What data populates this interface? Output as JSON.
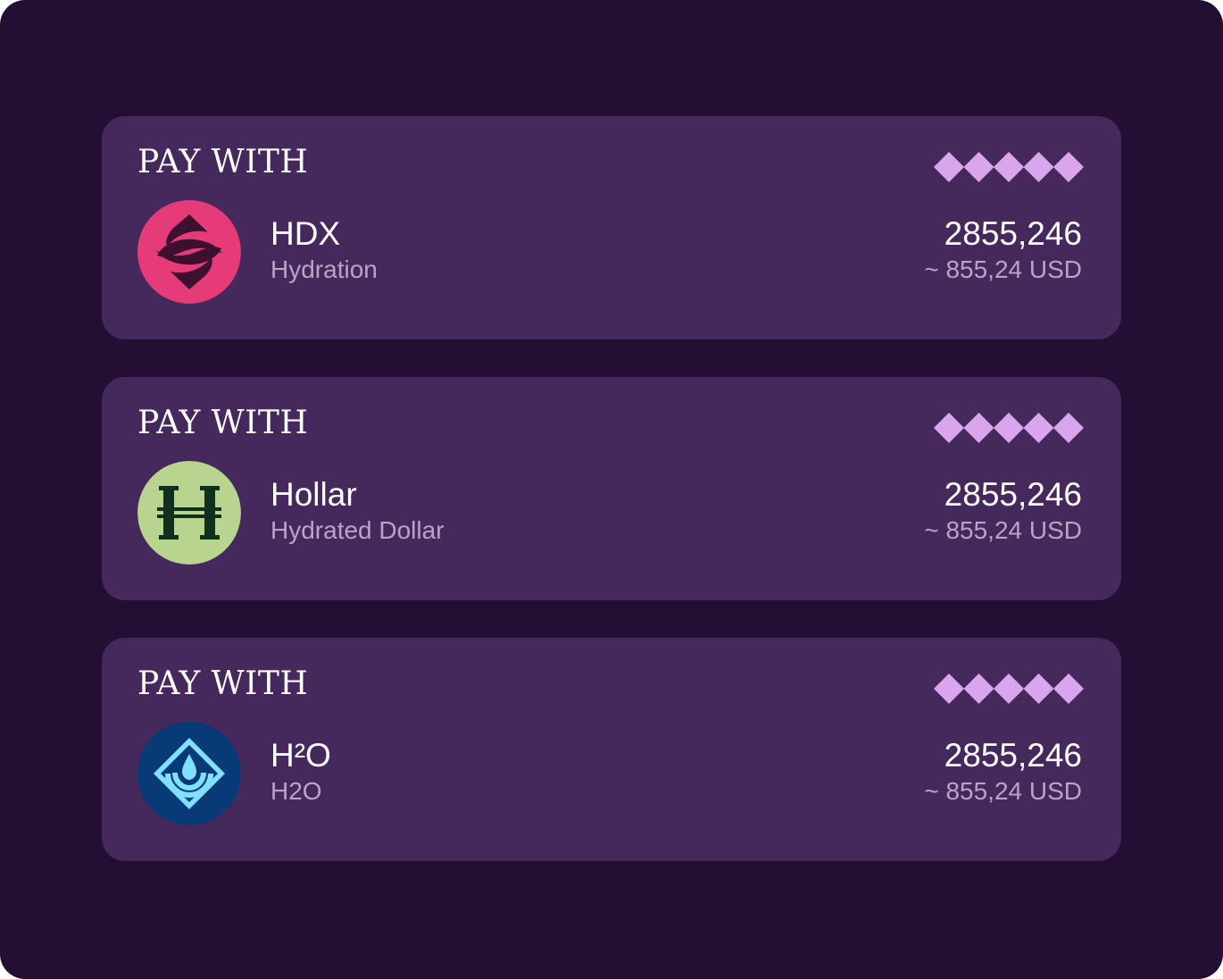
{
  "colors": {
    "frame_bg": "#220f33",
    "card_bg": "#45285c",
    "diamond": "#d9a6ee",
    "text_primary": "#ffffff",
    "text_secondary": "#b6a6c6",
    "hdx_logo_bg": "#e53b78",
    "hollar_logo_bg": "#b8d48f",
    "h2o_logo_bg": "#083a78",
    "h2o_logo_fg": "#7fe0ff"
  },
  "cards": [
    {
      "label": "PAY WITH",
      "rating_icon": "diamond-icon",
      "rating_count": 5,
      "token": {
        "symbol": "HDX",
        "name": "Hydration",
        "icon": "hdx-logo-icon"
      },
      "amount": "2855,246",
      "usd": "~ 855,24 USD"
    },
    {
      "label": "PAY WITH",
      "rating_icon": "diamond-icon",
      "rating_count": 5,
      "token": {
        "symbol": "Hollar",
        "name": "Hydrated Dollar",
        "icon": "hollar-logo-icon"
      },
      "amount": "2855,246",
      "usd": "~ 855,24 USD"
    },
    {
      "label": "PAY WITH",
      "rating_icon": "diamond-icon",
      "rating_count": 5,
      "token": {
        "symbol": "H²O",
        "name": "H2O",
        "icon": "h2o-logo-icon"
      },
      "amount": "2855,246",
      "usd": "~ 855,24 USD"
    }
  ]
}
